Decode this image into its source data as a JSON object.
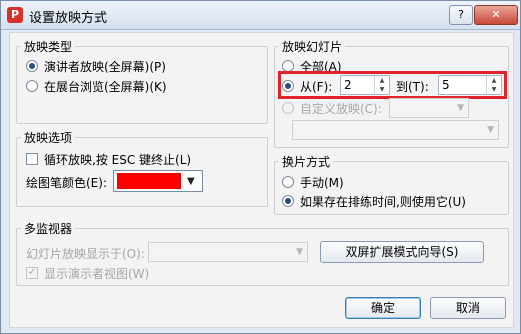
{
  "window": {
    "title": "设置放映方式",
    "app_icon": "wps-presentation-icon",
    "help_label": "?",
    "close_label": "✕"
  },
  "show_type": {
    "legend": "放映类型",
    "options": [
      {
        "label": "演讲者放映(全屏幕)(P)",
        "selected": true
      },
      {
        "label": "在展台浏览(全屏幕)(K)",
        "selected": false
      }
    ]
  },
  "slides": {
    "legend": "放映幻灯片",
    "all_label": "全部(A)",
    "from_label": "从(F):",
    "from_value": "2",
    "to_label": "到(T):",
    "to_value": "5",
    "custom_label": "自定义放映(C):",
    "custom_value": "",
    "highlight_color": "#e0232b"
  },
  "options": {
    "legend": "放映选项",
    "loop_label": "循环放映,按 ESC 键终止(L)",
    "loop_checked": false,
    "pen_color_label": "绘图笔颜色(E):",
    "pen_color": "#ff0000"
  },
  "advance": {
    "legend": "换片方式",
    "manual_label": "手动(M)",
    "timings_label": "如果存在排练时间,则使用它(U)",
    "selected": "timings"
  },
  "monitors": {
    "legend": "多监视器",
    "display_on_label": "幻灯片放映显示于(O):",
    "display_on_value": "",
    "wizard_button": "双屏扩展模式向导(S)",
    "presenter_view_label": "显示演示者视图(W)",
    "presenter_view_checked": true
  },
  "footer": {
    "ok_label": "确定",
    "cancel_label": "取消"
  }
}
